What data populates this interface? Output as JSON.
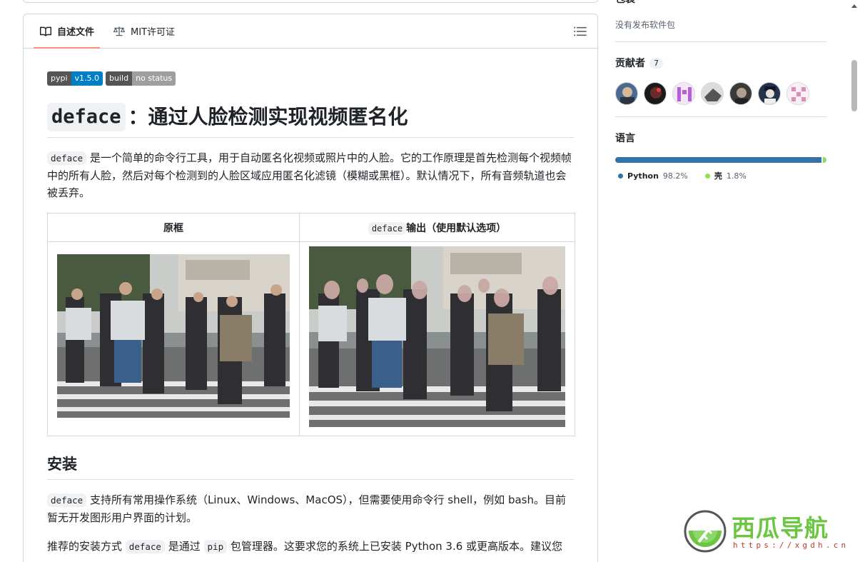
{
  "readme": {
    "tabs": [
      {
        "label": "自述文件",
        "icon": "book-icon",
        "active": true
      },
      {
        "label": "MIT许可证",
        "icon": "scale-icon",
        "active": false
      }
    ],
    "toc_icon": "list-icon",
    "badges": [
      {
        "left": "pypi",
        "right": "v1.5.0",
        "color": "#007ec6"
      },
      {
        "left": "build",
        "right": "no status",
        "color": "#9f9f9f"
      }
    ],
    "title_code": "deface",
    "title_rest": "：通过人脸检测实现视频匿名化",
    "intro_code": "deface",
    "intro_text": "是一个简单的命令行工具，用于自动匿名化视频或照片中的人脸。它的工作原理是首先检测每个视频帧中的所有人脸，然后对每个检测到的人脸区域应用匿名化滤镜（模糊或黑框）。默认情况下，所有音频轨道也会被丢弃。",
    "table": {
      "col1": "原框",
      "col2_code": "deface",
      "col2_text": "输出（使用默认选项）"
    },
    "install_heading": "安装",
    "install_p1_code": "deface",
    "install_p1_text": "支持所有常用操作系统（Linux、Windows、MacOS），但需要使用命令行 shell，例如 bash。目前暂无开发图形用户界面的计划。",
    "install_p2_a": "推荐的安装方式",
    "install_p2_code1": "deface",
    "install_p2_b": "是通过",
    "install_p2_code2": "pip",
    "install_p2_c": "包管理器。这要求您的系统上已安装 Python 3.6 或更高版本。建议您"
  },
  "sidebar": {
    "packages_heading": "包装",
    "packages_text": "没有发布软件包",
    "contributors_heading": "贡献者",
    "contributors_count": "7",
    "languages_heading": "语言",
    "languages": [
      {
        "name": "Python",
        "percent": "98.2%",
        "value": 98.2,
        "color": "#3572A5"
      },
      {
        "name": "壳",
        "percent": "1.8%",
        "value": 1.8,
        "color": "#89e051"
      }
    ]
  },
  "watermark": {
    "text": "西瓜导航",
    "url": "https://xgdh.cn"
  }
}
